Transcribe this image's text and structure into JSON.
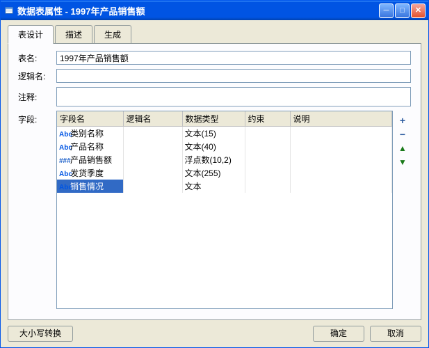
{
  "window": {
    "title": "数据表属性 - 1997年产品销售额"
  },
  "tabs": {
    "design": "表设计",
    "desc": "描述",
    "gen": "生成"
  },
  "form": {
    "table_name_label": "表名:",
    "table_name_value": "1997年产品销售额",
    "logical_name_label": "逻辑名:",
    "logical_name_value": "",
    "comment_label": "注释:",
    "comment_value": "",
    "fields_label": "字段:"
  },
  "grid": {
    "headers": {
      "field_name": "字段名",
      "logical_name": "逻辑名",
      "data_type": "数据类型",
      "constraint": "约束",
      "desc": "说明"
    },
    "rows": [
      {
        "icon": "Abc",
        "name": "类别名称",
        "logic": "",
        "type": "文本(15)",
        "con": "",
        "desc": ""
      },
      {
        "icon": "Abc",
        "name": "产品名称",
        "logic": "",
        "type": "文本(40)",
        "con": "",
        "desc": ""
      },
      {
        "icon": "###",
        "name": "产品销售额",
        "logic": "",
        "type": "浮点数(10,2)",
        "con": "",
        "desc": ""
      },
      {
        "icon": "Abc",
        "name": "发货季度",
        "logic": "",
        "type": "文本(255)",
        "con": "",
        "desc": ""
      },
      {
        "icon": "Abc",
        "name": "销售情况",
        "logic": "",
        "type": "文本",
        "con": "",
        "desc": "",
        "selected": true
      }
    ]
  },
  "side": {
    "add": "+",
    "remove": "−",
    "up": "▲",
    "down": "▼"
  },
  "footer": {
    "case_convert": "大小写转换",
    "ok": "确定",
    "cancel": "取消"
  }
}
